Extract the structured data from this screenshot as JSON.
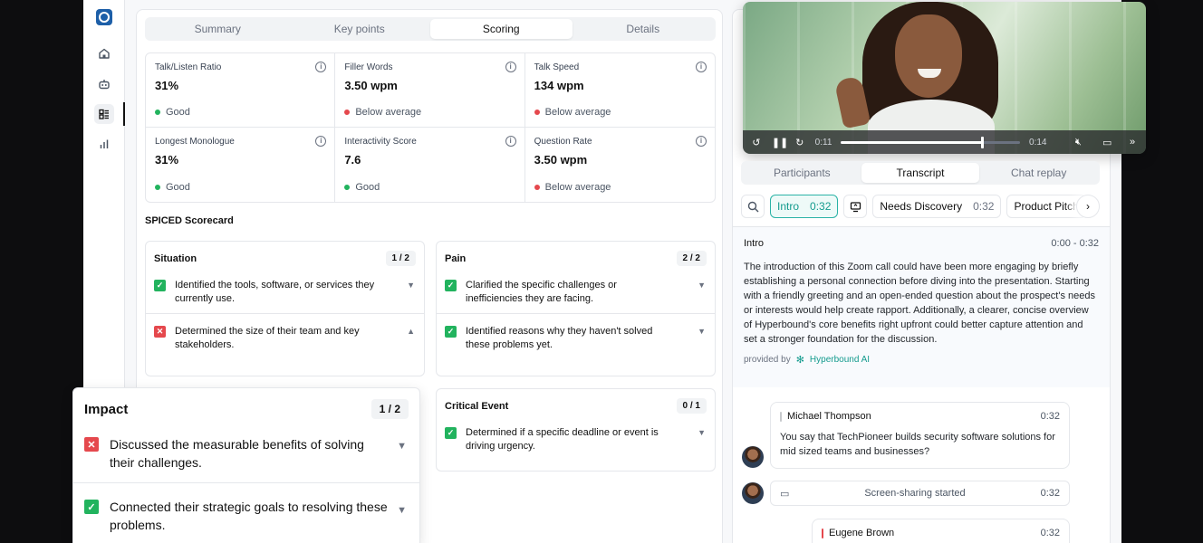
{
  "sidebar": {
    "icons": [
      "home-icon",
      "bot-icon",
      "list-icon",
      "bar-chart-icon"
    ]
  },
  "tabs": [
    {
      "label": "Summary"
    },
    {
      "label": "Key points"
    },
    {
      "label": "Scoring"
    },
    {
      "label": "Details"
    }
  ],
  "metrics": [
    {
      "label": "Talk/Listen Ratio",
      "value": "31%",
      "status": "Good",
      "color": "#22b35e"
    },
    {
      "label": "Filler Words",
      "value": "3.50 wpm",
      "status": "Below average",
      "color": "#e5484d"
    },
    {
      "label": "Talk Speed",
      "value": "134 wpm",
      "status": "Below average",
      "color": "#e5484d"
    },
    {
      "label": "Longest Monologue",
      "value": "31%",
      "status": "Good",
      "color": "#22b35e"
    },
    {
      "label": "Interactivity Score",
      "value": "7.6",
      "status": "Good",
      "color": "#22b35e"
    },
    {
      "label": "Question Rate",
      "value": "3.50 wpm",
      "status": "Below average",
      "color": "#e5484d"
    }
  ],
  "scorecard": {
    "title": "SPICED Scorecard",
    "situation": {
      "title": "Situation",
      "score": "1 / 2",
      "items": [
        {
          "text": "Identified the tools, software, or services they currently use.",
          "done": true
        },
        {
          "text": "Determined the size of their team and key stakeholders.",
          "done": false
        }
      ]
    },
    "pain": {
      "title": "Pain",
      "score": "2 / 2",
      "items": [
        {
          "text": "Clarified the specific challenges or inefficiencies they are facing.",
          "done": true
        },
        {
          "text": "Identified reasons why they haven't solved these problems yet.",
          "done": true
        }
      ]
    },
    "critical_event": {
      "title": "Critical Event",
      "score": "0 / 1",
      "items": [
        {
          "text": "Determined if a specific deadline or event is driving urgency.",
          "done": true
        }
      ]
    },
    "impact": {
      "title": "Impact",
      "score": "1 / 2",
      "items": [
        {
          "text": "Discussed the measurable benefits of solving their challenges.",
          "done": false
        },
        {
          "text": "Connected their strategic goals to resolving these problems.",
          "done": true
        }
      ]
    }
  },
  "video": {
    "current_time": "0:11",
    "duration": "0:14",
    "progress": 0.786
  },
  "right_tabs": [
    {
      "label": "Participants"
    },
    {
      "label": "Transcript"
    },
    {
      "label": "Chat replay"
    }
  ],
  "chips": [
    {
      "label": "Intro",
      "time": "0:32"
    },
    {
      "label": "Needs Discovery",
      "time": "0:32"
    },
    {
      "label": "Product Pitch",
      "time": ""
    }
  ],
  "summary": {
    "title": "Intro",
    "range": "0:00 - 0:32",
    "body": "The introduction of this Zoom call could have been more engaging by briefly establishing a personal connection before diving into the presentation. Starting with a friendly greeting and an open-ended question about the prospect's needs or interests would help create rapport. Additionally, a clearer, concise overview of Hyperbound's core benefits right upfront could better capture attention and set a stronger foundation for the discussion.",
    "provided_by": "provided by",
    "brand": "Hyperbound AI"
  },
  "messages": [
    {
      "name": "Michael Thompson",
      "time": "0:32",
      "text": "You say that TechPioneer builds security software solutions for mid sized teams and businesses?",
      "color": "#c7c9cc"
    },
    {
      "name": "Eugene Brown",
      "time": "0:32",
      "text": "",
      "color": "#e5484d"
    }
  ],
  "event": {
    "text": "Screen-sharing started",
    "time": "0:32"
  }
}
